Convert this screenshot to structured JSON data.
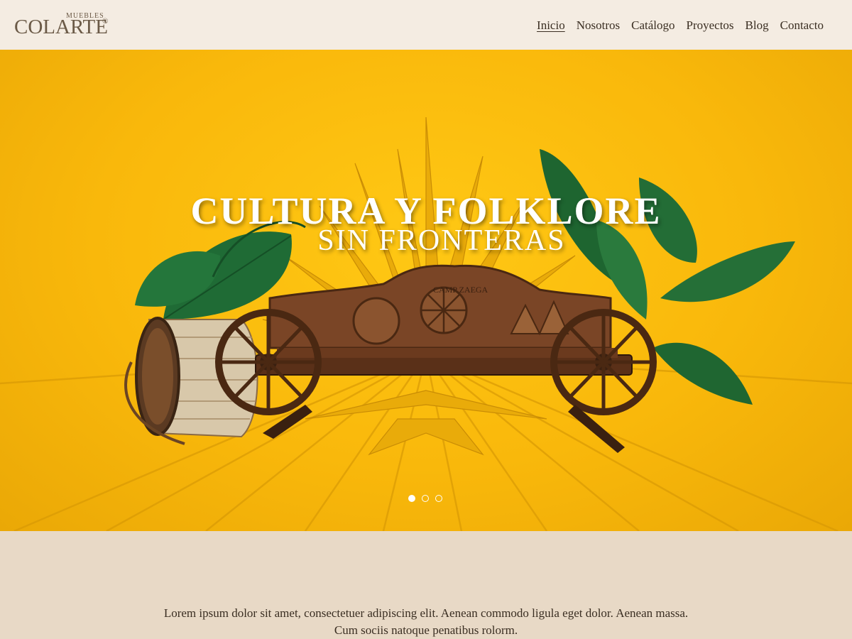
{
  "brand": {
    "small": "MUEBLES",
    "name": "COLARTE",
    "mark": "®"
  },
  "nav": {
    "items": [
      {
        "label": "Inicio",
        "active": true
      },
      {
        "label": "Nosotros",
        "active": false
      },
      {
        "label": "Catálogo",
        "active": false
      },
      {
        "label": "Proyectos",
        "active": false
      },
      {
        "label": "Blog",
        "active": false
      },
      {
        "label": "Contacto",
        "active": false
      }
    ]
  },
  "hero": {
    "title": "CULTURA Y FOLKLORE",
    "subtitle": "SIN FRONTERAS",
    "bench_carving": "CAMP ZAEGA",
    "slides": 3,
    "active_slide": 1
  },
  "intro": {
    "text": "Lorem ipsum dolor sit amet, consectetuer adipiscing elit. Aenean commodo ligula eget dolor. Aenean massa. Cum sociis natoque penatibus rolorm."
  },
  "colors": {
    "header_bg": "#f4ece2",
    "hero_yellow": "#f9b80b",
    "section_bg": "#e8d9c6",
    "text_dark": "#3a2e22"
  }
}
